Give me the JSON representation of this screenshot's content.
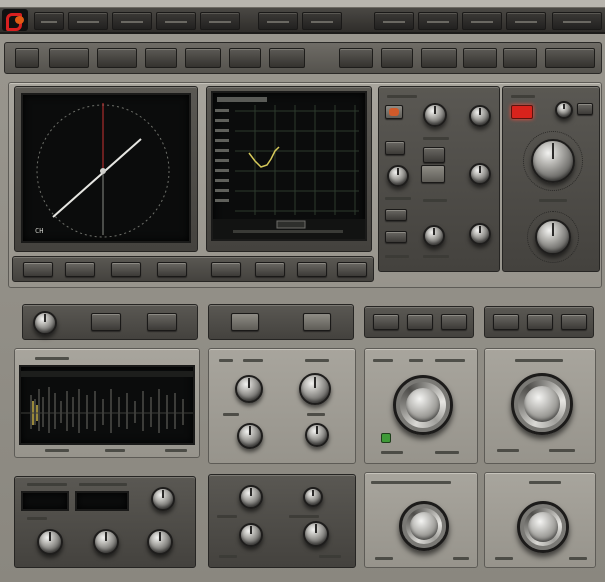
{
  "app": {
    "title": "",
    "logo": "app-logo"
  },
  "menu_tabs": [
    "",
    "",
    "",
    "",
    "",
    "",
    "",
    "",
    "",
    "",
    "",
    "",
    ""
  ],
  "toolbar_buttons": 14,
  "scope": {
    "label": "",
    "corner_readout": "",
    "bottom_left": "CH"
  },
  "graph": {
    "header": "",
    "trace_color": "#d6c95a",
    "grid_color": "#2d3a2d"
  },
  "controls": {
    "indicator_red": "#d8231c",
    "indicator_orange": "#d05a2a",
    "indicator_green": "#3f9a38"
  },
  "waveform": {
    "trace_color": "#c9b24a"
  },
  "icons": [
    "app-logo",
    "rotary-knob",
    "push-button",
    "status-led"
  ]
}
